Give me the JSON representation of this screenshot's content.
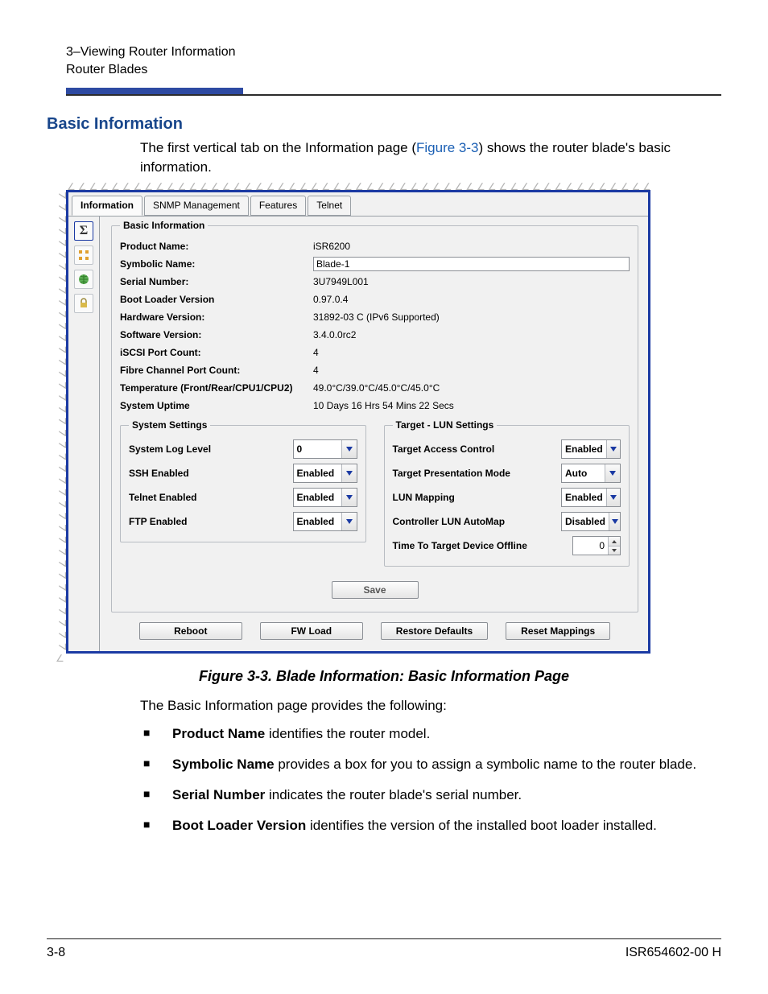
{
  "header": {
    "chapter": "3–Viewing Router Information",
    "section": "Router Blades"
  },
  "section_heading": "Basic Information",
  "intro": {
    "pre": "The first vertical tab on the Information page (",
    "xref": "Figure 3-3",
    "post": ") shows the router blade's basic information."
  },
  "screenshot": {
    "tabs": {
      "information": "Information",
      "snmp": "SNMP Management",
      "features": "Features",
      "telnet": "Telnet"
    },
    "group_legend": "Basic Information",
    "fields": {
      "product_name": {
        "label": "Product Name:",
        "value": "iSR6200"
      },
      "symbolic_name": {
        "label": "Symbolic Name:",
        "value": "Blade-1"
      },
      "serial_number": {
        "label": "Serial Number:",
        "value": "3U7949L001"
      },
      "boot_loader": {
        "label": "Boot Loader Version",
        "value": "0.97.0.4"
      },
      "hw_version": {
        "label": "Hardware Version:",
        "value": "31892-03  C  (IPv6 Supported)"
      },
      "sw_version": {
        "label": "Software Version:",
        "value": "3.4.0.0rc2"
      },
      "iscsi_ports": {
        "label": "iSCSI Port Count:",
        "value": "4"
      },
      "fc_ports": {
        "label": "Fibre Channel Port Count:",
        "value": "4"
      },
      "temperature": {
        "label": "Temperature (Front/Rear/CPU1/CPU2)",
        "value": "49.0°C/39.0°C/45.0°C/45.0°C"
      },
      "uptime": {
        "label": "System Uptime",
        "value": "10 Days 16 Hrs 54 Mins 22 Secs"
      }
    },
    "system_settings": {
      "legend": "System Settings",
      "rows": {
        "log_level": {
          "label": "System Log Level",
          "value": "0"
        },
        "ssh": {
          "label": "SSH Enabled",
          "value": "Enabled"
        },
        "telnet": {
          "label": "Telnet Enabled",
          "value": "Enabled"
        },
        "ftp": {
          "label": "FTP Enabled",
          "value": "Enabled"
        }
      }
    },
    "lun_settings": {
      "legend": "Target - LUN Settings",
      "rows": {
        "access_ctrl": {
          "label": "Target Access Control",
          "value": "Enabled"
        },
        "pres_mode": {
          "label": "Target Presentation Mode",
          "value": "Auto"
        },
        "lun_map": {
          "label": "LUN Mapping",
          "value": "Enabled"
        },
        "auto_map": {
          "label": "Controller LUN AutoMap",
          "value": "Disabled"
        },
        "time_offline": {
          "label": "Time To Target Device Offline",
          "value": "0"
        }
      }
    },
    "buttons": {
      "save": "Save",
      "reboot": "Reboot",
      "fwload": "FW Load",
      "restore": "Restore Defaults",
      "reset_map": "Reset Mappings"
    }
  },
  "figure_caption": "Figure 3-3. Blade Information: Basic Information Page",
  "after_caption_intro": "The Basic Information page provides the following:",
  "bullets": {
    "b1": {
      "bold": "Product Name",
      "rest": " identifies the router model."
    },
    "b2": {
      "bold": "Symbolic Name",
      "rest": " provides a box for you to assign a symbolic name to the router blade."
    },
    "b3": {
      "bold": "Serial Number",
      "rest": " indicates the router blade's serial number."
    },
    "b4": {
      "bold": "Boot Loader Version",
      "rest": " identifies the version of the installed boot loader installed."
    }
  },
  "footer": {
    "left": "3-8",
    "right": "ISR654602-00  H"
  }
}
